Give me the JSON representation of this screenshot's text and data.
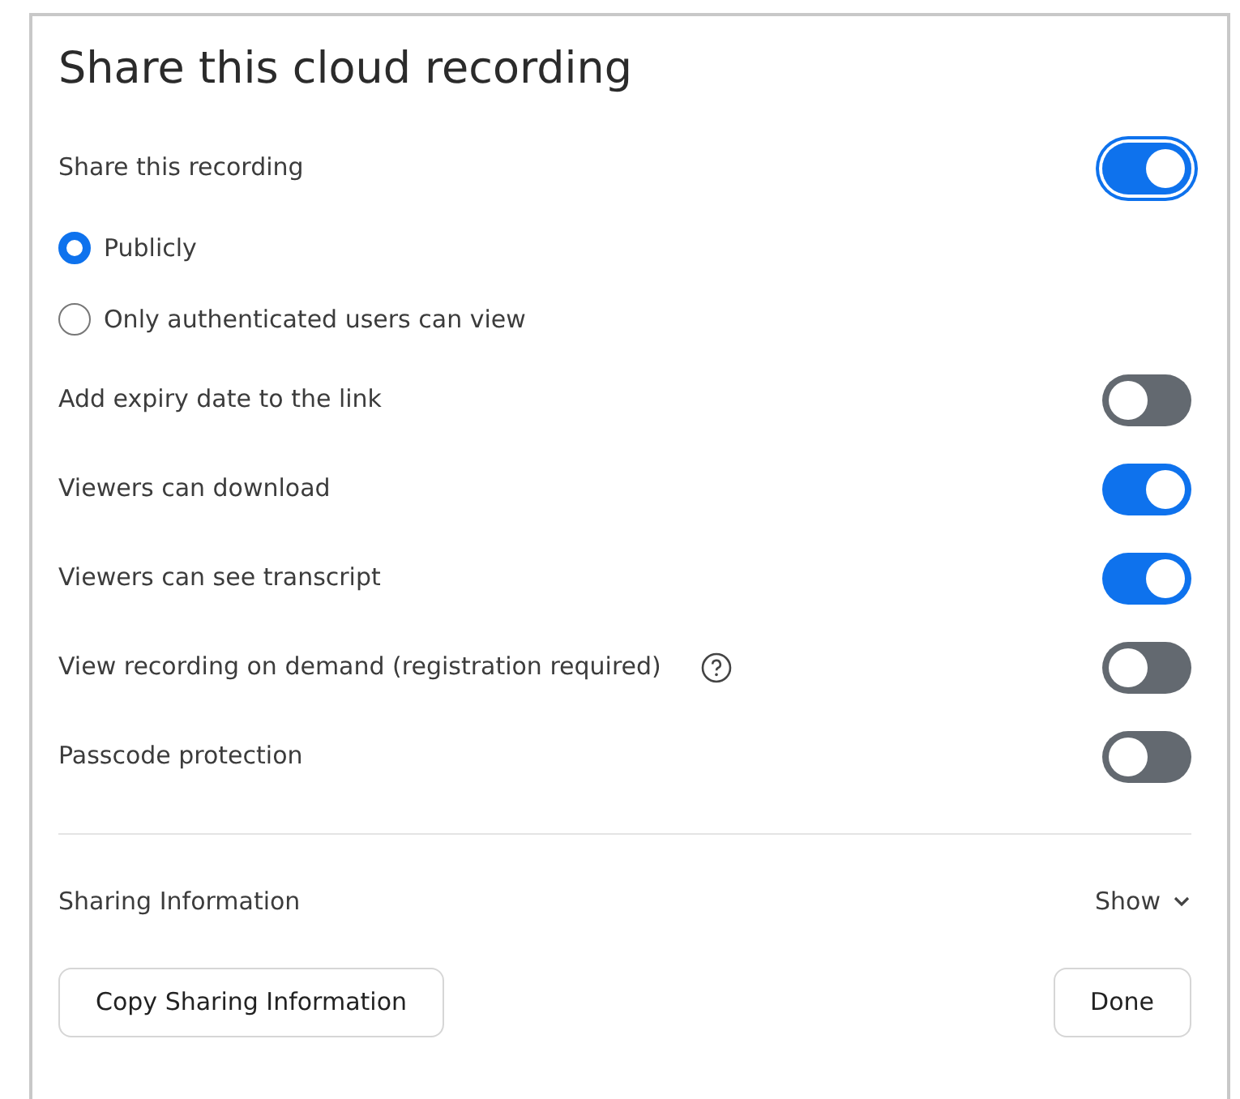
{
  "dialog": {
    "title": "Share this cloud recording",
    "settings": [
      {
        "kind": "toggle",
        "label": "Share this recording",
        "on": true,
        "focused": true,
        "help": false
      },
      {
        "kind": "radio",
        "label": "Publicly",
        "selected": true
      },
      {
        "kind": "radio",
        "label": "Only authenticated users can view",
        "selected": false
      },
      {
        "kind": "toggle",
        "label": "Add expiry date to the link",
        "on": false,
        "focused": false,
        "help": false
      },
      {
        "kind": "toggle",
        "label": "Viewers can download",
        "on": true,
        "focused": false,
        "help": false
      },
      {
        "kind": "toggle",
        "label": "Viewers can see transcript",
        "on": true,
        "focused": false,
        "help": false
      },
      {
        "kind": "toggle",
        "label": "View recording on demand (registration required)",
        "on": false,
        "focused": false,
        "help": true
      },
      {
        "kind": "toggle",
        "label": "Passcode protection",
        "on": false,
        "focused": false,
        "help": false
      }
    ],
    "sharing_information": {
      "label": "Sharing Information",
      "toggle_label": "Show"
    },
    "buttons": [
      "Copy Sharing Information",
      "Done"
    ]
  }
}
